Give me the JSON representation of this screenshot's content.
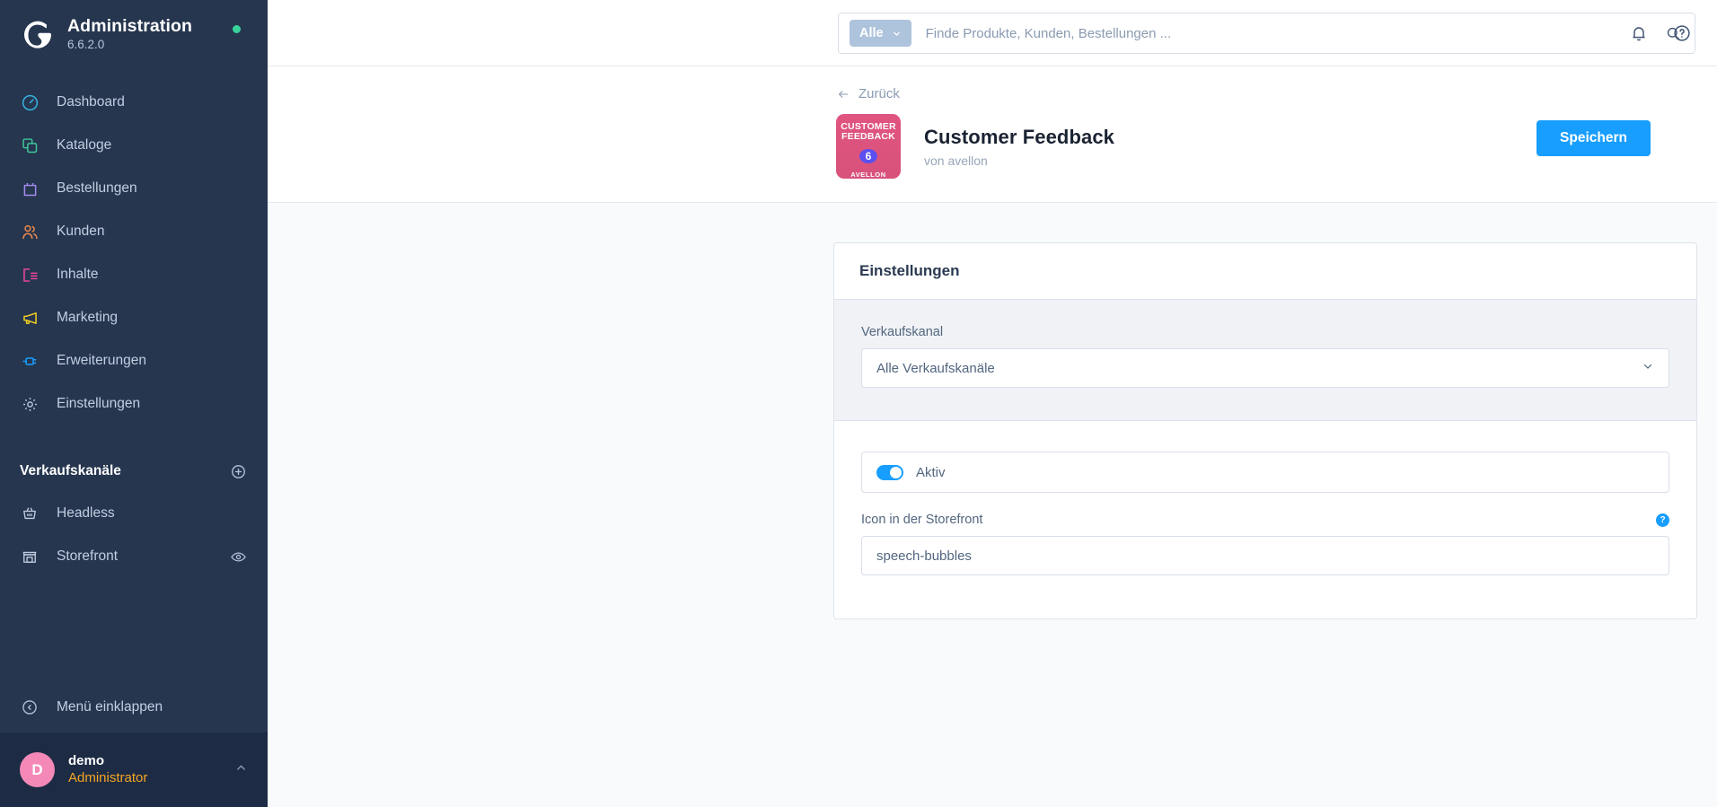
{
  "sidebar": {
    "title": "Administration",
    "version": "6.6.2.0",
    "status_dot_color": "#37d39b",
    "items": [
      {
        "label": "Dashboard",
        "icon": "speedometer-icon",
        "color": "#37b3e0"
      },
      {
        "label": "Kataloge",
        "icon": "copy-icon",
        "color": "#3ec79a"
      },
      {
        "label": "Bestellungen",
        "icon": "bag-icon",
        "color": "#a48bf0"
      },
      {
        "label": "Kunden",
        "icon": "users-icon",
        "color": "#f08a4b"
      },
      {
        "label": "Inhalte",
        "icon": "content-icon",
        "color": "#f248a0"
      },
      {
        "label": "Marketing",
        "icon": "megaphone-icon",
        "color": "#f5d020"
      },
      {
        "label": "Erweiterungen",
        "icon": "plug-icon",
        "color": "#189eff"
      },
      {
        "label": "Einstellungen",
        "icon": "gear-icon",
        "color": "#b6c4d8"
      }
    ],
    "section": {
      "title": "Verkaufskanäle",
      "add_icon": "plus-circle-icon"
    },
    "channels": [
      {
        "label": "Headless",
        "icon": "basket-icon",
        "trailing_icon": ""
      },
      {
        "label": "Storefront",
        "icon": "store-icon",
        "trailing_icon": "eye-icon"
      }
    ],
    "collapse": {
      "label": "Menü einklappen",
      "icon": "collapse-left-icon"
    },
    "user": {
      "initial": "D",
      "name": "demo",
      "role": "Administrator",
      "avatar_color": "#f489b8",
      "role_color": "#f5a623",
      "caret_icon": "chevron-up-icon"
    }
  },
  "topbar": {
    "scope_label": "Alle",
    "scope_caret_icon": "chevron-down-icon",
    "search_placeholder": "Finde Produkte, Kunden, Bestellungen ...",
    "search_value": "",
    "search_icon": "search-icon",
    "notification_icon": "bell-icon",
    "help_icon": "question-circle-icon"
  },
  "plugin_header": {
    "back_label": "Zurück",
    "back_icon": "arrow-left-icon",
    "icon": {
      "line1": "CUSTOMER",
      "line2": "FEEDBACK",
      "badge": "6",
      "brand": "AVELLON",
      "bg_color": "#d8527c",
      "badge_color": "#5b4ff0"
    },
    "title": "Customer Feedback",
    "author": "von avellon",
    "save_label": "Speichern",
    "save_color": "#189eff"
  },
  "settings_card": {
    "heading": "Einstellungen",
    "sales_channel": {
      "label": "Verkaufskanal",
      "value": "Alle Verkaufskanäle",
      "caret_icon": "chevron-down-icon"
    },
    "active_toggle": {
      "label": "Aktiv",
      "state": "on",
      "color": "#189eff"
    },
    "storefront_icon_field": {
      "label": "Icon in der Storefront",
      "value": "speech-bubbles",
      "help_icon": "help-circle-icon",
      "help_color": "#189eff"
    }
  }
}
